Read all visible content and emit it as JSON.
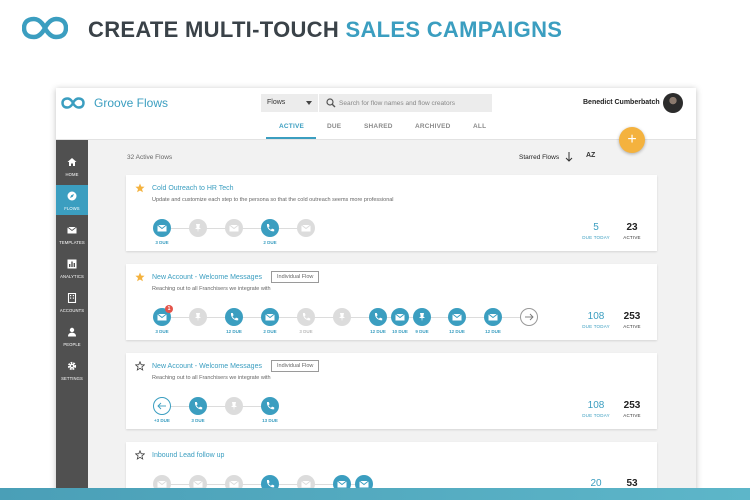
{
  "hero": {
    "title_main": "CREATE MULTI-TOUCH ",
    "title_accent": "SALES CAMPAIGNS",
    "logo_icon": "infinity-logo-icon"
  },
  "colors": {
    "accent": "#3b9ec0",
    "fab": "#f4b23e",
    "sidebar": "#505050",
    "star": "#f4b23e",
    "notification": "#e4544a"
  },
  "app": {
    "name": "Groove Flows",
    "filter_select": "Flows",
    "search_placeholder": "Search for flow names and flow creators",
    "user_name": "Benedict Cumberbatch",
    "fab_label": "+"
  },
  "tabs": [
    {
      "label": "ACTIVE",
      "active": true
    },
    {
      "label": "DUE",
      "active": false
    },
    {
      "label": "SHARED",
      "active": false
    },
    {
      "label": "ARCHIVED",
      "active": false
    },
    {
      "label": "ALL",
      "active": false
    }
  ],
  "sidebar": {
    "items": [
      {
        "label": "HOME",
        "icon": "home-icon",
        "active": false
      },
      {
        "label": "FLOWS",
        "icon": "compass-icon",
        "active": true
      },
      {
        "label": "TEMPLATES",
        "icon": "envelope-icon",
        "active": false
      },
      {
        "label": "ANALYTICS",
        "icon": "bar-chart-icon",
        "active": false
      },
      {
        "label": "ACCOUNTS",
        "icon": "building-icon",
        "active": false
      },
      {
        "label": "PEOPLE",
        "icon": "person-icon",
        "active": false
      },
      {
        "label": "SETTINGS",
        "icon": "gear-icon",
        "active": false
      }
    ]
  },
  "list": {
    "count_label": "32 Active Flows",
    "sort_label": "Starred Flows",
    "az_label": "AZ"
  },
  "flows": [
    {
      "title": "Cold Outreach to HR Tech",
      "starred": true,
      "badge": "",
      "description": "Update and customize each step to the persona so that the cold outreach seems more professional",
      "due_today": "5",
      "due_today_label": "DUE TODAY",
      "active": "23",
      "active_label": "ACTIVE",
      "labels": [
        "3 DUE",
        "2 DUE"
      ]
    },
    {
      "title": "New Account - Welcome Messages",
      "starred": true,
      "badge": "Individual Flow",
      "description": "Reaching out to all Franchisers we integrate with",
      "due_today": "108",
      "due_today_label": "DUE TODAY",
      "active": "253",
      "active_label": "ACTIVE",
      "notification": "1",
      "labels": [
        "3 DUE",
        "12 DUE",
        "2 DUE",
        "3 DUE",
        "12 DUE",
        "10 DUE",
        "9 DUE",
        "12 DUE",
        "12 DUE"
      ]
    },
    {
      "title": "New Account - Welcome Messages",
      "starred": false,
      "badge": "Individual Flow",
      "description": "Reaching out to all Franchisers we integrate with",
      "due_today": "108",
      "due_today_label": "DUE TODAY",
      "active": "253",
      "active_label": "ACTIVE",
      "labels": [
        "+3 DUE",
        "3 DUE",
        "13 DUE"
      ]
    },
    {
      "title": "Inbound Lead follow up",
      "starred": false,
      "badge": "",
      "description": "",
      "due_today": "20",
      "active": "53"
    }
  ]
}
